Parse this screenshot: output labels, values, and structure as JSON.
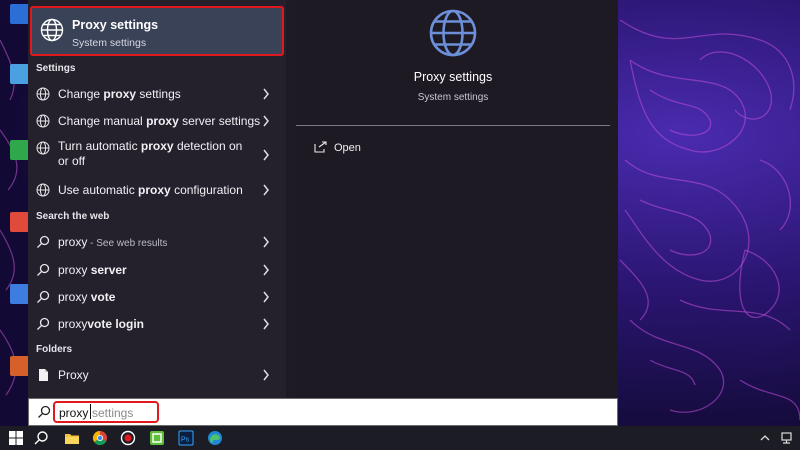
{
  "best_match": {
    "title": "Proxy settings",
    "subtitle": "System settings"
  },
  "sections": {
    "settings": "Settings",
    "web": "Search the web",
    "folders": "Folders"
  },
  "settings_items": [
    {
      "pre": "Change ",
      "bold": "proxy",
      "post": " settings"
    },
    {
      "pre": "Change manual ",
      "bold": "proxy",
      "post": " server settings"
    },
    {
      "pre": "Turn automatic ",
      "bold": "proxy",
      "post": " detection on or off"
    },
    {
      "pre": "Use automatic ",
      "bold": "proxy",
      "post": " configuration"
    }
  ],
  "web_items": [
    {
      "pre": "proxy",
      "hint": " - See web results",
      "bold": ""
    },
    {
      "pre": "proxy ",
      "bold": "server",
      "hint": ""
    },
    {
      "pre": "proxy ",
      "bold": "vote",
      "hint": ""
    },
    {
      "pre": "proxy",
      "bold": "vote login",
      "hint": ""
    }
  ],
  "folder_items": [
    {
      "label": "Proxy"
    }
  ],
  "preview": {
    "title": "Proxy settings",
    "subtitle": "System settings",
    "open_label": "Open"
  },
  "search": {
    "typed": "proxy",
    "suggestion": "settings"
  },
  "taskbar": {
    "tray_up": "^"
  },
  "colors": {
    "highlight_border": "#e0191e",
    "globe_blue": "#6d8fd9"
  }
}
